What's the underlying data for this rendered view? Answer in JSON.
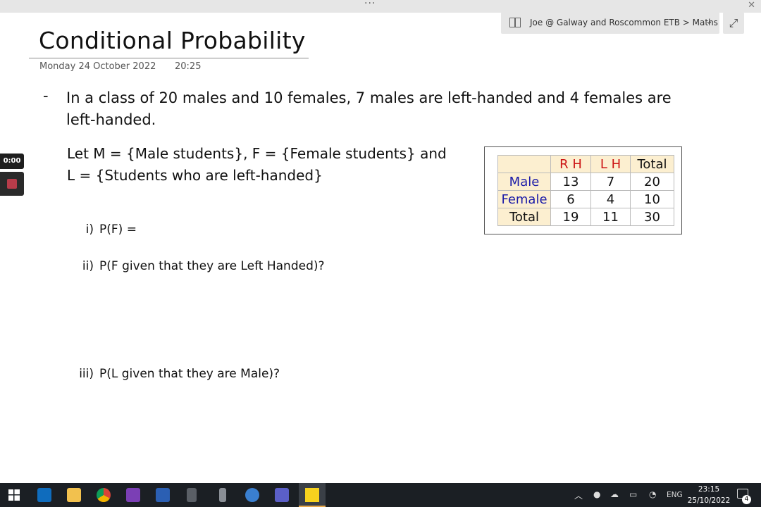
{
  "window": {
    "dots": "···",
    "close": "✕"
  },
  "breadcrumb": {
    "text": "Joe @ Galway and Roscommon ETB > Maths",
    "chevron": "⌄"
  },
  "expand_icon": "⤢",
  "page": {
    "title": "Conditional Probability",
    "date": "Monday 24 October 2022",
    "time": "20:25"
  },
  "recording": {
    "timer": "0:00"
  },
  "content": {
    "bullet": "-",
    "intro": "In a class of 20 males and 10 females, 7 males are left-handed and 4 females are left-handed.",
    "let_line1": "Let M = {Male students}, F = {Female students} and",
    "let_line2": "L = {Students who are left-handed}",
    "questions": [
      {
        "num": "i)",
        "text": "P(F) ="
      },
      {
        "num": "ii)",
        "text": "P(F given that they are Left Handed)?"
      },
      {
        "num": "iii)",
        "text": "P(L given that they are Male)?"
      }
    ]
  },
  "table": {
    "headers": [
      "",
      "R H",
      "L H",
      "Total"
    ],
    "rows": [
      {
        "label": "Male",
        "values": [
          "13",
          "7",
          "20"
        ]
      },
      {
        "label": "Female",
        "values": [
          "6",
          "4",
          "10"
        ]
      },
      {
        "label": "Total",
        "values": [
          "19",
          "11",
          "30"
        ]
      }
    ],
    "colors": {
      "header_red": "#cc1414",
      "label_blue": "#1a1aa8",
      "shade": "#fcefd0"
    }
  },
  "taskbar": {
    "apps": [
      "windows-start",
      "outlook",
      "file-explorer",
      "chrome",
      "onenote",
      "word",
      "calculator",
      "phone",
      "app-circle",
      "teams",
      "sticky-notes"
    ],
    "language": "ENG",
    "clock_time": "23:15",
    "clock_date": "25/10/2022",
    "notification_count": "4"
  }
}
